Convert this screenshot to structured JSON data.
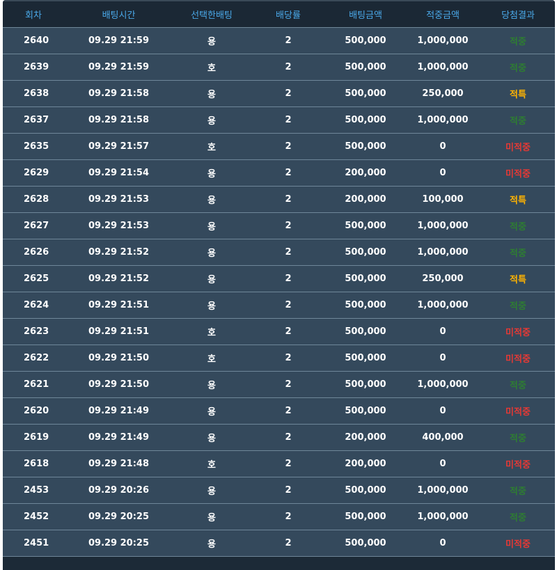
{
  "colors": {
    "header_text": "#4aa8e8",
    "row_bg": "#34495c",
    "win": "#2e7d32",
    "special": "#ffb300",
    "miss": "#e53935"
  },
  "table": {
    "headers": [
      "회차",
      "배팅시간",
      "선택한배팅",
      "배당률",
      "배팅금액",
      "적중금액",
      "당첨결과"
    ],
    "rows": [
      {
        "round": "2640",
        "time": "09.29 21:59",
        "pick": "용",
        "odds": "2",
        "bet": "500,000",
        "payout": "1,000,000",
        "result": "적중",
        "status": "win"
      },
      {
        "round": "2639",
        "time": "09.29 21:59",
        "pick": "호",
        "odds": "2",
        "bet": "500,000",
        "payout": "1,000,000",
        "result": "적중",
        "status": "win"
      },
      {
        "round": "2638",
        "time": "09.29 21:58",
        "pick": "용",
        "odds": "2",
        "bet": "500,000",
        "payout": "250,000",
        "result": "적특",
        "status": "special"
      },
      {
        "round": "2637",
        "time": "09.29 21:58",
        "pick": "용",
        "odds": "2",
        "bet": "500,000",
        "payout": "1,000,000",
        "result": "적중",
        "status": "win"
      },
      {
        "round": "2635",
        "time": "09.29 21:57",
        "pick": "호",
        "odds": "2",
        "bet": "500,000",
        "payout": "0",
        "result": "미적중",
        "status": "miss"
      },
      {
        "round": "2629",
        "time": "09.29 21:54",
        "pick": "용",
        "odds": "2",
        "bet": "200,000",
        "payout": "0",
        "result": "미적중",
        "status": "miss"
      },
      {
        "round": "2628",
        "time": "09.29 21:53",
        "pick": "용",
        "odds": "2",
        "bet": "200,000",
        "payout": "100,000",
        "result": "적특",
        "status": "special"
      },
      {
        "round": "2627",
        "time": "09.29 21:53",
        "pick": "용",
        "odds": "2",
        "bet": "500,000",
        "payout": "1,000,000",
        "result": "적중",
        "status": "win"
      },
      {
        "round": "2626",
        "time": "09.29 21:52",
        "pick": "용",
        "odds": "2",
        "bet": "500,000",
        "payout": "1,000,000",
        "result": "적중",
        "status": "win"
      },
      {
        "round": "2625",
        "time": "09.29 21:52",
        "pick": "용",
        "odds": "2",
        "bet": "500,000",
        "payout": "250,000",
        "result": "적특",
        "status": "special"
      },
      {
        "round": "2624",
        "time": "09.29 21:51",
        "pick": "용",
        "odds": "2",
        "bet": "500,000",
        "payout": "1,000,000",
        "result": "적중",
        "status": "win"
      },
      {
        "round": "2623",
        "time": "09.29 21:51",
        "pick": "호",
        "odds": "2",
        "bet": "500,000",
        "payout": "0",
        "result": "미적중",
        "status": "miss"
      },
      {
        "round": "2622",
        "time": "09.29 21:50",
        "pick": "호",
        "odds": "2",
        "bet": "500,000",
        "payout": "0",
        "result": "미적중",
        "status": "miss"
      },
      {
        "round": "2621",
        "time": "09.29 21:50",
        "pick": "용",
        "odds": "2",
        "bet": "500,000",
        "payout": "1,000,000",
        "result": "적중",
        "status": "win"
      },
      {
        "round": "2620",
        "time": "09.29 21:49",
        "pick": "용",
        "odds": "2",
        "bet": "500,000",
        "payout": "0",
        "result": "미적중",
        "status": "miss"
      },
      {
        "round": "2619",
        "time": "09.29 21:49",
        "pick": "용",
        "odds": "2",
        "bet": "200,000",
        "payout": "400,000",
        "result": "적중",
        "status": "win"
      },
      {
        "round": "2618",
        "time": "09.29 21:48",
        "pick": "호",
        "odds": "2",
        "bet": "200,000",
        "payout": "0",
        "result": "미적중",
        "status": "miss"
      },
      {
        "round": "2453",
        "time": "09.29 20:26",
        "pick": "용",
        "odds": "2",
        "bet": "500,000",
        "payout": "1,000,000",
        "result": "적중",
        "status": "win"
      },
      {
        "round": "2452",
        "time": "09.29 20:25",
        "pick": "용",
        "odds": "2",
        "bet": "500,000",
        "payout": "1,000,000",
        "result": "적중",
        "status": "win"
      },
      {
        "round": "2451",
        "time": "09.29 20:25",
        "pick": "용",
        "odds": "2",
        "bet": "500,000",
        "payout": "0",
        "result": "미적중",
        "status": "miss"
      }
    ]
  }
}
